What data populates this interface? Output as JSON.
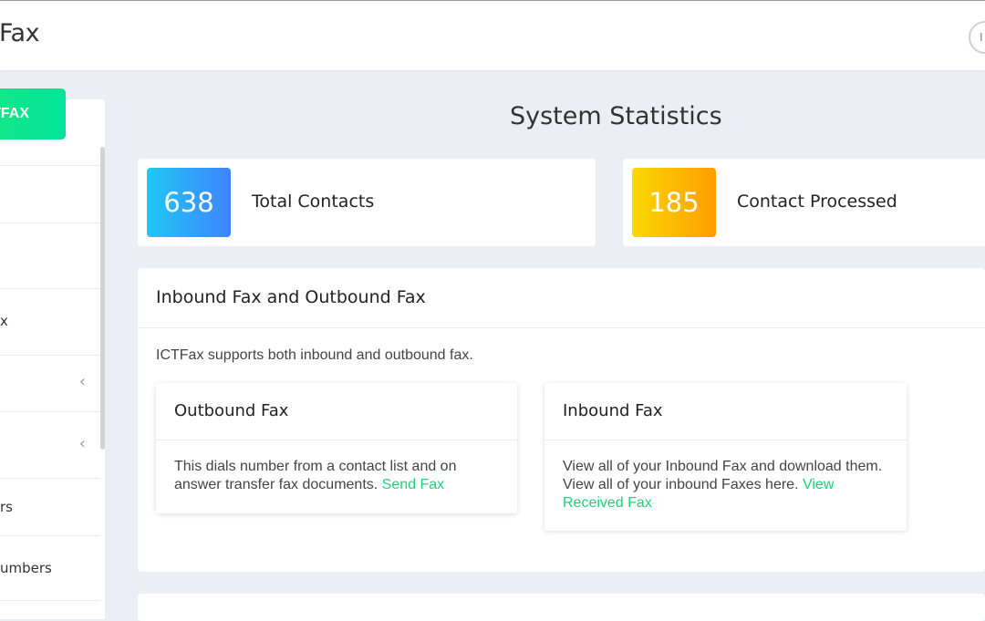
{
  "header": {
    "app_title": "Fax",
    "avatar_initial": "I"
  },
  "sidebar": {
    "brand_label": "TFAX",
    "items": [
      {
        "label": ""
      },
      {
        "label": ""
      },
      {
        "label": "x"
      },
      {
        "label": "",
        "chevron": "‹"
      },
      {
        "label": "",
        "chevron": "‹"
      },
      {
        "label": "rs"
      },
      {
        "label": "umbers"
      }
    ]
  },
  "main": {
    "heading": "System Statistics",
    "stats": [
      {
        "value": "638",
        "label": "Total Contacts"
      },
      {
        "value": "185",
        "label": "Contact Processed"
      }
    ],
    "panel": {
      "title": "Inbound Fax and Outbound Fax",
      "description": "ICTFax supports both inbound and outbound fax.",
      "outbound": {
        "title": "Outbound Fax",
        "line1": "This dials number from a contact list and on",
        "line2": "answer transfer fax documents.",
        "link": "Send Fax"
      },
      "inbound": {
        "title": "Inbound Fax",
        "line1": "View all of your Inbound Fax and download them.",
        "line2": "View all of your inbound Faxes here.",
        "link1": "View",
        "link2": "Received Fax"
      }
    }
  },
  "colors": {
    "brand": "#12e68a",
    "link": "#1fd07a",
    "stat_blue": "#4083fd",
    "stat_orange": "#fd9d00"
  }
}
